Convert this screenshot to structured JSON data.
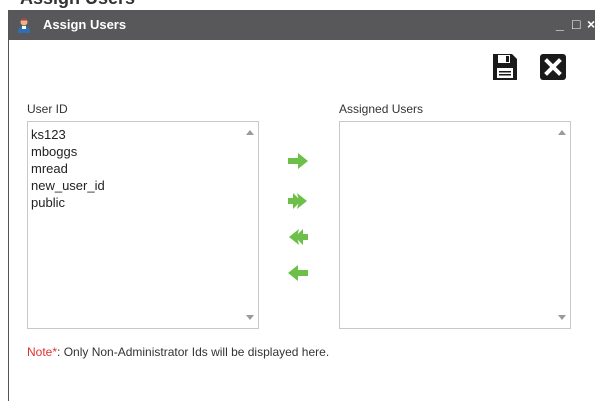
{
  "page_header": {
    "partial_title": "Assign Users"
  },
  "window": {
    "title": "Assign Users",
    "minimize_glyph": "_",
    "maximize_glyph": "□",
    "close_glyph": "×"
  },
  "toolbar": {
    "save_icon": "save-icon",
    "close_icon": "close-icon"
  },
  "user_list": {
    "label": "User ID",
    "items": [
      "ks123",
      "mboggs",
      "mread",
      "new_user_id",
      "public"
    ]
  },
  "assigned_list": {
    "label": "Assigned Users",
    "items": []
  },
  "transfer_buttons": [
    "move-right-icon",
    "move-all-right-icon",
    "move-all-left-icon",
    "move-left-icon"
  ],
  "note": {
    "label": "Note*",
    "text": ": Only Non-Administrator Ids will be displayed here."
  },
  "colors": {
    "titlebar": "#58585a",
    "arrow_green": "#6cc04a",
    "note_red": "#e03030"
  }
}
